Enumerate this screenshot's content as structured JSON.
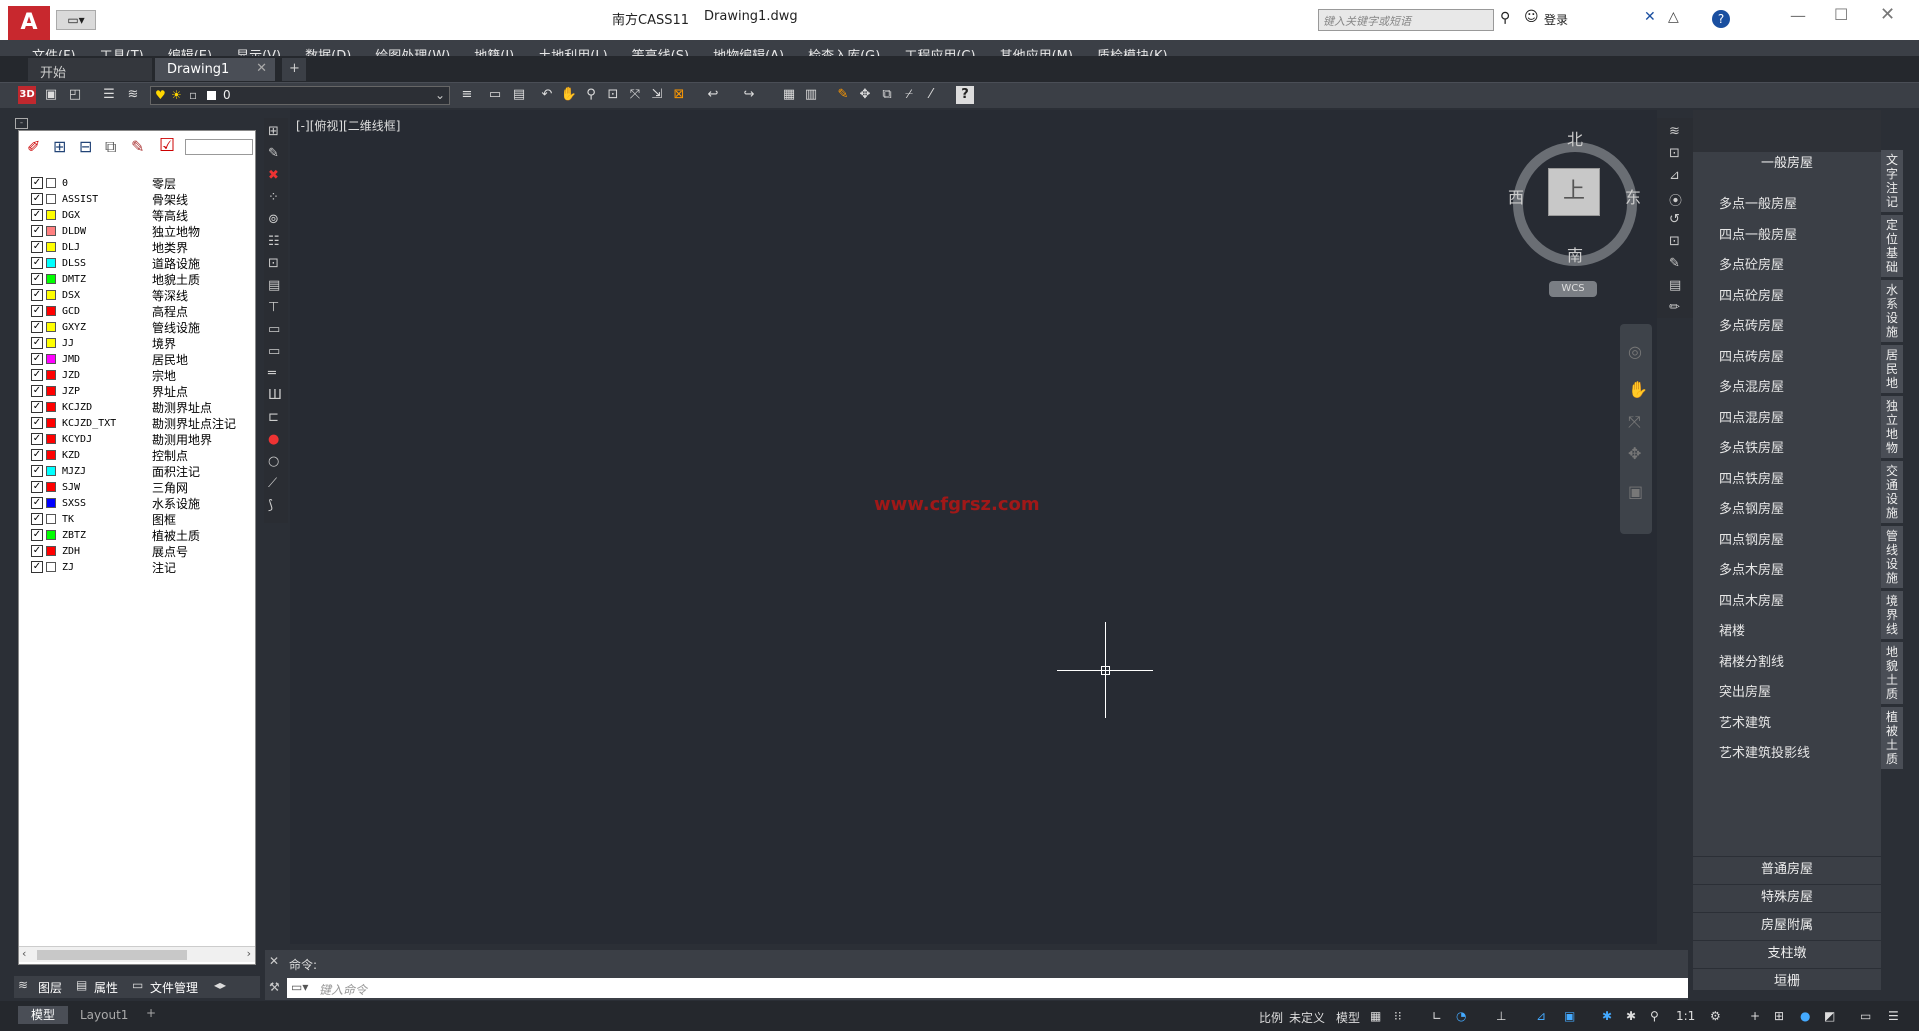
{
  "title": {
    "app": "南方CASS11",
    "doc": "Drawing1.dwg",
    "search_placeholder": "键入关键字或短语",
    "login": "登录"
  },
  "menu": [
    "文件(F)",
    "工具(T)",
    "编辑(E)",
    "显示(V)",
    "数据(D)",
    "绘图处理(W)",
    "地籍(J)",
    "土地利用(L)",
    "等高线(S)",
    "地物编辑(A)",
    "检查入库(G)",
    "工程应用(C)",
    "其他应用(M)",
    "质检模块(K)"
  ],
  "tabs": {
    "start": "开始",
    "drawing": "Drawing1",
    "add": "+"
  },
  "toolbar": {
    "layer_value": "0",
    "label_3d": "3D"
  },
  "layers": [
    {
      "name": "0",
      "desc": "零层",
      "color": "#ffffff"
    },
    {
      "name": "ASSIST",
      "desc": "骨架线",
      "color": "#ffffff"
    },
    {
      "name": "DGX",
      "desc": "等高线",
      "color": "#ffff00"
    },
    {
      "name": "DLDW",
      "desc": "独立地物",
      "color": "#ff8080"
    },
    {
      "name": "DLJ",
      "desc": "地类界",
      "color": "#ffff00"
    },
    {
      "name": "DLSS",
      "desc": "道路设施",
      "color": "#00ffff"
    },
    {
      "name": "DMTZ",
      "desc": "地貌土质",
      "color": "#00ff00"
    },
    {
      "name": "DSX",
      "desc": "等深线",
      "color": "#ffff00"
    },
    {
      "name": "GCD",
      "desc": "高程点",
      "color": "#ff0000"
    },
    {
      "name": "GXYZ",
      "desc": "管线设施",
      "color": "#ffff00"
    },
    {
      "name": "JJ",
      "desc": "境界",
      "color": "#ffff00"
    },
    {
      "name": "JMD",
      "desc": "居民地",
      "color": "#ff00ff"
    },
    {
      "name": "JZD",
      "desc": "宗地",
      "color": "#ff0000"
    },
    {
      "name": "JZP",
      "desc": "界址点",
      "color": "#ff0000"
    },
    {
      "name": "KCJZD",
      "desc": "勘测界址点",
      "color": "#ff0000"
    },
    {
      "name": "KCJZD_TXT",
      "desc": "勘测界址点注记",
      "color": "#ff0000"
    },
    {
      "name": "KCYDJ",
      "desc": "勘测用地界",
      "color": "#ff0000"
    },
    {
      "name": "KZD",
      "desc": "控制点",
      "color": "#ff0000"
    },
    {
      "name": "MJZJ",
      "desc": "面积注记",
      "color": "#00ffff"
    },
    {
      "name": "SJW",
      "desc": "三角网",
      "color": "#ff0000"
    },
    {
      "name": "SXSS",
      "desc": "水系设施",
      "color": "#0000ff"
    },
    {
      "name": "TK",
      "desc": "图框",
      "color": "#ffffff"
    },
    {
      "name": "ZBTZ",
      "desc": "植被土质",
      "color": "#00ff00"
    },
    {
      "name": "ZDH",
      "desc": "展点号",
      "color": "#ff0000"
    },
    {
      "name": "ZJ",
      "desc": "注记",
      "color": "#ffffff"
    }
  ],
  "panel_tabs": {
    "layers": "图层",
    "props": "属性",
    "files": "文件管理"
  },
  "viewport": {
    "label": "[-][俯视][二维线框]",
    "watermark": "www.cfgrsz.com"
  },
  "viewcube": {
    "north": "北",
    "south": "南",
    "east": "东",
    "west": "西",
    "top": "上",
    "wcs": "WCS"
  },
  "rpanel": {
    "header": "一般房屋",
    "items": [
      "多点一般房屋",
      "四点一般房屋",
      "多点砼房屋",
      "四点砼房屋",
      "多点砖房屋",
      "四点砖房屋",
      "多点混房屋",
      "四点混房屋",
      "多点铁房屋",
      "四点铁房屋",
      "多点钢房屋",
      "四点钢房屋",
      "多点木房屋",
      "四点木房屋",
      "裙楼",
      "裙楼分割线",
      "突出房屋",
      "艺术建筑",
      "艺术建筑投影线"
    ],
    "sections": [
      "普通房屋",
      "特殊房屋",
      "房屋附属",
      "支柱墩",
      "垣栅"
    ]
  },
  "vtabs": [
    "文字注记",
    "定位基础",
    "水系设施",
    "居民地",
    "独立地物",
    "交通设施",
    "管线设施",
    "境界线",
    "地貌土质",
    "植被土质"
  ],
  "command": {
    "prompt": "命令:",
    "placeholder": "键入命令"
  },
  "status": {
    "model": "模型",
    "layout1": "Layout1",
    "scale_label": "比例",
    "scale_value": "未定义",
    "model_btn": "模型",
    "ratio": "1:1"
  }
}
